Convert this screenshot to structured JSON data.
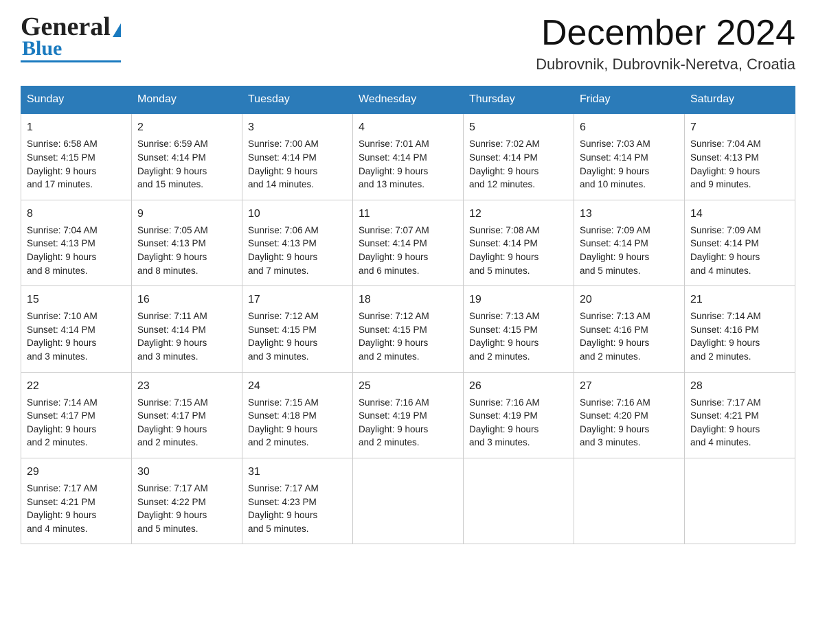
{
  "header": {
    "logo_general": "General",
    "logo_blue": "Blue",
    "month_year": "December 2024",
    "location": "Dubrovnik, Dubrovnik-Neretva, Croatia"
  },
  "days_of_week": [
    "Sunday",
    "Monday",
    "Tuesday",
    "Wednesday",
    "Thursday",
    "Friday",
    "Saturday"
  ],
  "weeks": [
    [
      {
        "day": "1",
        "sunrise": "6:58 AM",
        "sunset": "4:15 PM",
        "daylight": "9 hours and 17 minutes."
      },
      {
        "day": "2",
        "sunrise": "6:59 AM",
        "sunset": "4:14 PM",
        "daylight": "9 hours and 15 minutes."
      },
      {
        "day": "3",
        "sunrise": "7:00 AM",
        "sunset": "4:14 PM",
        "daylight": "9 hours and 14 minutes."
      },
      {
        "day": "4",
        "sunrise": "7:01 AM",
        "sunset": "4:14 PM",
        "daylight": "9 hours and 13 minutes."
      },
      {
        "day": "5",
        "sunrise": "7:02 AM",
        "sunset": "4:14 PM",
        "daylight": "9 hours and 12 minutes."
      },
      {
        "day": "6",
        "sunrise": "7:03 AM",
        "sunset": "4:14 PM",
        "daylight": "9 hours and 10 minutes."
      },
      {
        "day": "7",
        "sunrise": "7:04 AM",
        "sunset": "4:13 PM",
        "daylight": "9 hours and 9 minutes."
      }
    ],
    [
      {
        "day": "8",
        "sunrise": "7:04 AM",
        "sunset": "4:13 PM",
        "daylight": "9 hours and 8 minutes."
      },
      {
        "day": "9",
        "sunrise": "7:05 AM",
        "sunset": "4:13 PM",
        "daylight": "9 hours and 8 minutes."
      },
      {
        "day": "10",
        "sunrise": "7:06 AM",
        "sunset": "4:13 PM",
        "daylight": "9 hours and 7 minutes."
      },
      {
        "day": "11",
        "sunrise": "7:07 AM",
        "sunset": "4:14 PM",
        "daylight": "9 hours and 6 minutes."
      },
      {
        "day": "12",
        "sunrise": "7:08 AM",
        "sunset": "4:14 PM",
        "daylight": "9 hours and 5 minutes."
      },
      {
        "day": "13",
        "sunrise": "7:09 AM",
        "sunset": "4:14 PM",
        "daylight": "9 hours and 5 minutes."
      },
      {
        "day": "14",
        "sunrise": "7:09 AM",
        "sunset": "4:14 PM",
        "daylight": "9 hours and 4 minutes."
      }
    ],
    [
      {
        "day": "15",
        "sunrise": "7:10 AM",
        "sunset": "4:14 PM",
        "daylight": "9 hours and 3 minutes."
      },
      {
        "day": "16",
        "sunrise": "7:11 AM",
        "sunset": "4:14 PM",
        "daylight": "9 hours and 3 minutes."
      },
      {
        "day": "17",
        "sunrise": "7:12 AM",
        "sunset": "4:15 PM",
        "daylight": "9 hours and 3 minutes."
      },
      {
        "day": "18",
        "sunrise": "7:12 AM",
        "sunset": "4:15 PM",
        "daylight": "9 hours and 2 minutes."
      },
      {
        "day": "19",
        "sunrise": "7:13 AM",
        "sunset": "4:15 PM",
        "daylight": "9 hours and 2 minutes."
      },
      {
        "day": "20",
        "sunrise": "7:13 AM",
        "sunset": "4:16 PM",
        "daylight": "9 hours and 2 minutes."
      },
      {
        "day": "21",
        "sunrise": "7:14 AM",
        "sunset": "4:16 PM",
        "daylight": "9 hours and 2 minutes."
      }
    ],
    [
      {
        "day": "22",
        "sunrise": "7:14 AM",
        "sunset": "4:17 PM",
        "daylight": "9 hours and 2 minutes."
      },
      {
        "day": "23",
        "sunrise": "7:15 AM",
        "sunset": "4:17 PM",
        "daylight": "9 hours and 2 minutes."
      },
      {
        "day": "24",
        "sunrise": "7:15 AM",
        "sunset": "4:18 PM",
        "daylight": "9 hours and 2 minutes."
      },
      {
        "day": "25",
        "sunrise": "7:16 AM",
        "sunset": "4:19 PM",
        "daylight": "9 hours and 2 minutes."
      },
      {
        "day": "26",
        "sunrise": "7:16 AM",
        "sunset": "4:19 PM",
        "daylight": "9 hours and 3 minutes."
      },
      {
        "day": "27",
        "sunrise": "7:16 AM",
        "sunset": "4:20 PM",
        "daylight": "9 hours and 3 minutes."
      },
      {
        "day": "28",
        "sunrise": "7:17 AM",
        "sunset": "4:21 PM",
        "daylight": "9 hours and 4 minutes."
      }
    ],
    [
      {
        "day": "29",
        "sunrise": "7:17 AM",
        "sunset": "4:21 PM",
        "daylight": "9 hours and 4 minutes."
      },
      {
        "day": "30",
        "sunrise": "7:17 AM",
        "sunset": "4:22 PM",
        "daylight": "9 hours and 5 minutes."
      },
      {
        "day": "31",
        "sunrise": "7:17 AM",
        "sunset": "4:23 PM",
        "daylight": "9 hours and 5 minutes."
      },
      null,
      null,
      null,
      null
    ]
  ],
  "labels": {
    "sunrise": "Sunrise:",
    "sunset": "Sunset:",
    "daylight": "Daylight:"
  }
}
